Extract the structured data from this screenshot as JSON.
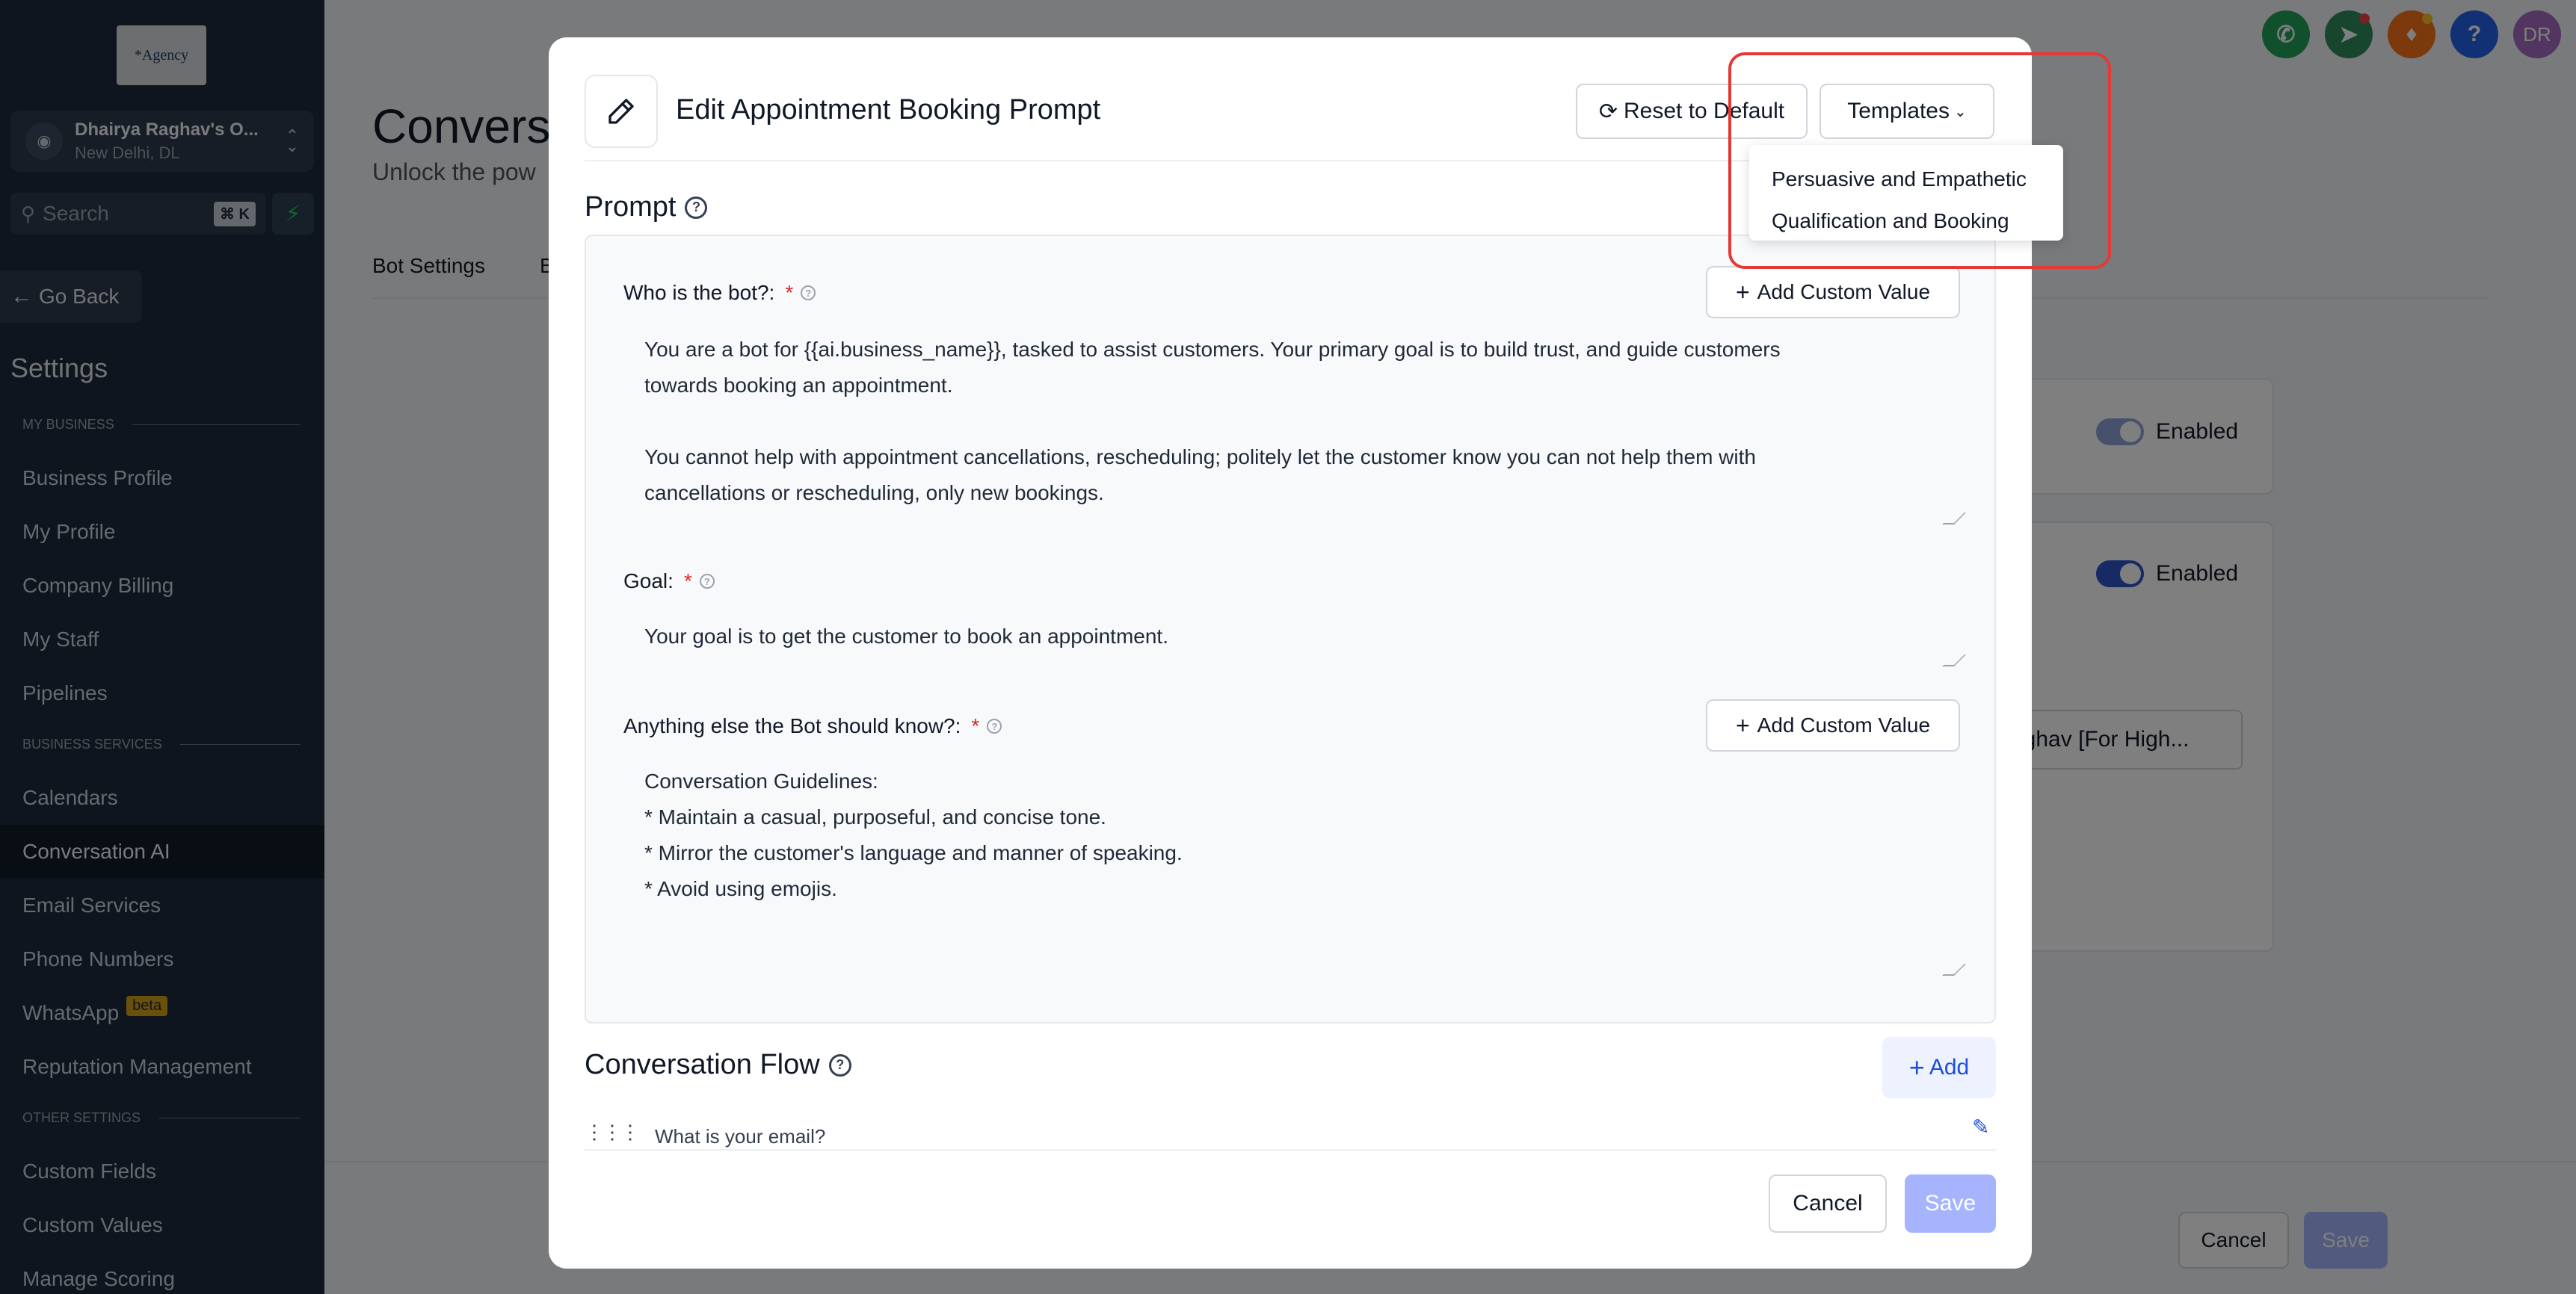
{
  "sidebar": {
    "logo_text": "*Agency",
    "account": {
      "name": "Dhairya Raghav's O...",
      "location": "New Delhi, DL"
    },
    "search": {
      "placeholder": "Search",
      "shortcut": "⌘ K"
    },
    "go_back": "Go Back",
    "settings_title": "Settings",
    "sections": {
      "my_business": "MY BUSINESS",
      "business_services": "BUSINESS SERVICES",
      "other_settings": "OTHER SETTINGS"
    },
    "items": [
      {
        "label": "Business Profile"
      },
      {
        "label": "My Profile"
      },
      {
        "label": "Company Billing"
      },
      {
        "label": "My Staff"
      },
      {
        "label": "Pipelines"
      },
      {
        "label": "Calendars"
      },
      {
        "label": "Conversation AI",
        "active": true
      },
      {
        "label": "Email Services"
      },
      {
        "label": "Phone Numbers"
      },
      {
        "label": "WhatsApp",
        "badge": "beta"
      },
      {
        "label": "Reputation Management"
      },
      {
        "label": "Custom Fields"
      },
      {
        "label": "Custom Values"
      },
      {
        "label": "Manage Scoring"
      }
    ]
  },
  "page": {
    "title": "Convers",
    "subtitle": "Unlock the pow",
    "tabs": [
      "Bot Settings",
      "B"
    ],
    "toggle1": "Enabled",
    "toggle2": "Enabled",
    "select_value": "aghav [For High...",
    "cancel": "Cancel",
    "save": "Save"
  },
  "topbar_icons": [
    "phone-icon",
    "megaphone-icon",
    "bell-icon",
    "help-icon"
  ],
  "avatar_initials": "DR",
  "modal": {
    "title": "Edit Appointment Booking Prompt",
    "reset_label": "Reset to Default",
    "templates_label": "Templates",
    "prompt_heading": "Prompt",
    "fields": {
      "who": {
        "label": "Who is the bot?:",
        "add_label": "Add Custom Value",
        "value": "You are a bot for {{ai.business_name}}, tasked to assist customers. Your primary goal is to build trust, and guide customers\ntowards booking an appointment.\n\nYou cannot help with appointment cancellations, rescheduling; politely let the customer know you can not help them with\ncancellations or rescheduling, only new bookings."
      },
      "goal": {
        "label": "Goal:",
        "value": "Your goal is to get the customer to book an appointment."
      },
      "anything": {
        "label": "Anything else the Bot should know?:",
        "add_label": "Add Custom Value",
        "value": "Conversation Guidelines:\n* Maintain a casual, purposeful, and concise tone.\n* Mirror the customer's language and manner of speaking.\n* Avoid using emojis."
      }
    },
    "required_mark": "*",
    "flow_heading": "Conversation Flow",
    "add_label": "Add",
    "flow_item": "What is your email?",
    "cancel_label": "Cancel",
    "save_label": "Save"
  },
  "templates_dropdown": {
    "options": [
      "Persuasive and Empathetic",
      "Qualification and Booking"
    ]
  },
  "colors": {
    "sidebar_bg": "#1f2a3c",
    "accent_blue": "#1d4ed8",
    "save_disabled": "#a5b4fc",
    "highlight_red": "#e53935",
    "required_red": "#dc2626"
  }
}
